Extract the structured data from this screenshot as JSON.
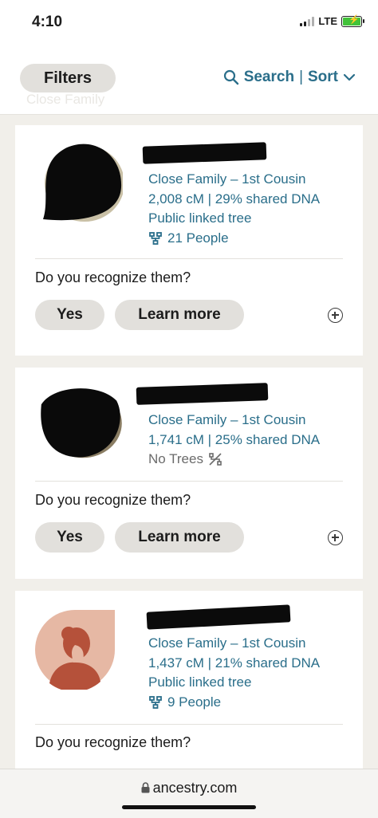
{
  "status_bar": {
    "time": "4:10",
    "network": "LTE",
    "battery_charging": true
  },
  "toolbar": {
    "filters_label": "Filters",
    "ghost_label": "Close Family",
    "search_label": "Search",
    "separator": "|",
    "sort_label": "Sort"
  },
  "matches": [
    {
      "relationship": "Close Family – 1st Cousin",
      "shared_dna": "2,008 cM | 29% shared DNA",
      "tree_status": "Public linked tree",
      "people_count": "21 People",
      "question": "Do you recognize them?",
      "yes_label": "Yes",
      "learn_more_label": "Learn more"
    },
    {
      "relationship": "Close Family – 1st Cousin",
      "shared_dna": "1,741 cM | 25% shared DNA",
      "tree_status": "No Trees",
      "question": "Do you recognize them?",
      "yes_label": "Yes",
      "learn_more_label": "Learn more"
    },
    {
      "relationship": "Close Family – 1st Cousin",
      "shared_dna": "1,437 cM | 21% shared DNA",
      "tree_status": "Public linked tree",
      "people_count": "9 People",
      "question": "Do you recognize them?"
    }
  ],
  "browser": {
    "url": "ancestry.com"
  },
  "colors": {
    "accent": "#2a6e8a",
    "pill": "#e2e0dc",
    "background": "#f1efea",
    "avatar_bg": "#e6b8a4",
    "avatar_figure": "#b5513a"
  }
}
